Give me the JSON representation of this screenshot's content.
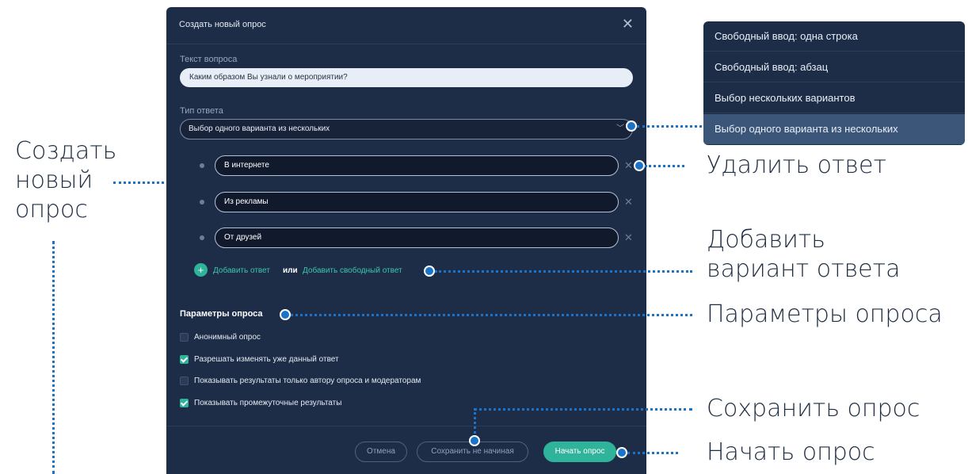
{
  "modal": {
    "title": "Создать новый опрос",
    "question_label": "Текст вопроса",
    "question_value": "Каким образом Вы узнали о мероприятии?",
    "answer_type_label": "Тип ответа",
    "answer_type_value": "Выбор одного варианта из нескольких",
    "options": [
      {
        "value": "В интернете"
      },
      {
        "value": "Из рекламы"
      },
      {
        "value": "От друзей"
      }
    ],
    "add_answer": "Добавить ответ",
    "or": "или",
    "add_free_answer": "Добавить свободный ответ",
    "params_title": "Параметры опроса",
    "params": [
      {
        "label": "Анонимный опрос",
        "checked": false
      },
      {
        "label": "Разрешать изменять уже данный ответ",
        "checked": true
      },
      {
        "label": "Показывать результаты только автору опроса и модераторам",
        "checked": false
      },
      {
        "label": "Показывать промежуточные результаты",
        "checked": true
      }
    ],
    "cancel": "Отмена",
    "save": "Сохранить не начиная",
    "start": "Начать опрос"
  },
  "dropdown": {
    "items": [
      "Свободный ввод: одна строка",
      "Свободный ввод: абзац",
      "Выбор нескольких вариантов",
      "Выбор одного варианта из нескольких"
    ],
    "selected": "Выбор одного варианта из нескольких"
  },
  "callouts": {
    "create_line1": "Создать",
    "create_line2": "новый",
    "create_line3": "опрос",
    "delete_answer": "Удалить ответ",
    "add_option_line1": "Добавить",
    "add_option_line2": "вариант ответа",
    "params": "Параметры опроса",
    "save_poll": "Сохранить опрос",
    "start_poll": "Начать опрос"
  },
  "colors": {
    "modal_bg": "#1e2d47",
    "accent": "#2fb39a",
    "callout_blue": "#1a73c9"
  }
}
